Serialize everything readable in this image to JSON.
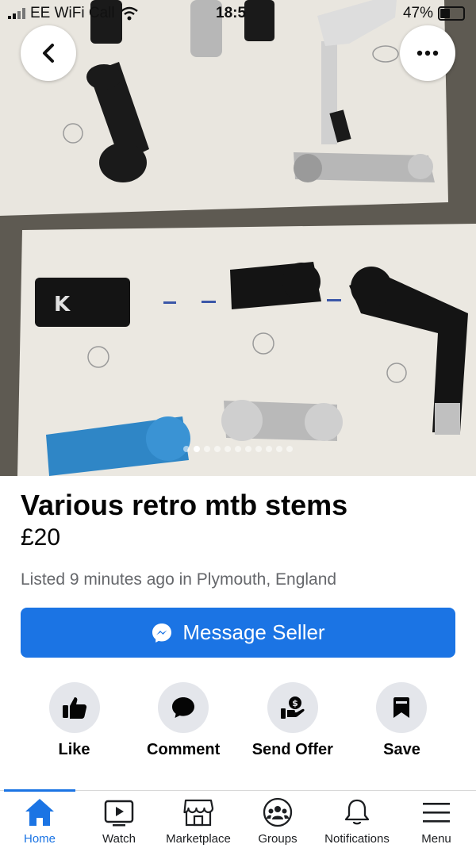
{
  "status_bar": {
    "carrier": "EE WiFi Call",
    "time": "18:5",
    "battery": "47%"
  },
  "photo": {
    "alt": "Various retro mtb stems photo",
    "page_count": 11,
    "active_page": 1
  },
  "listing": {
    "title": "Various retro mtb stems",
    "price": "£20",
    "listed": "Listed 9 minutes ago in Plymouth, England"
  },
  "message_button": {
    "label": "Message Seller"
  },
  "actions": [
    {
      "label": "Like",
      "icon": "thumbs-up-icon"
    },
    {
      "label": "Comment",
      "icon": "comment-icon"
    },
    {
      "label": "Send Offer",
      "icon": "send-offer-icon"
    },
    {
      "label": "Save",
      "icon": "bookmark-icon"
    }
  ],
  "tabs": [
    {
      "label": "Home",
      "icon": "home-icon",
      "active": true
    },
    {
      "label": "Watch",
      "icon": "watch-icon",
      "active": false
    },
    {
      "label": "Marketplace",
      "icon": "marketplace-icon",
      "active": false
    },
    {
      "label": "Groups",
      "icon": "groups-icon",
      "active": false
    },
    {
      "label": "Notifications",
      "icon": "bell-icon",
      "active": false
    },
    {
      "label": "Menu",
      "icon": "menu-icon",
      "active": false
    }
  ],
  "colors": {
    "accent": "#1b74e4",
    "secondary_text": "#65676b",
    "button_gray": "#e4e6eb"
  }
}
